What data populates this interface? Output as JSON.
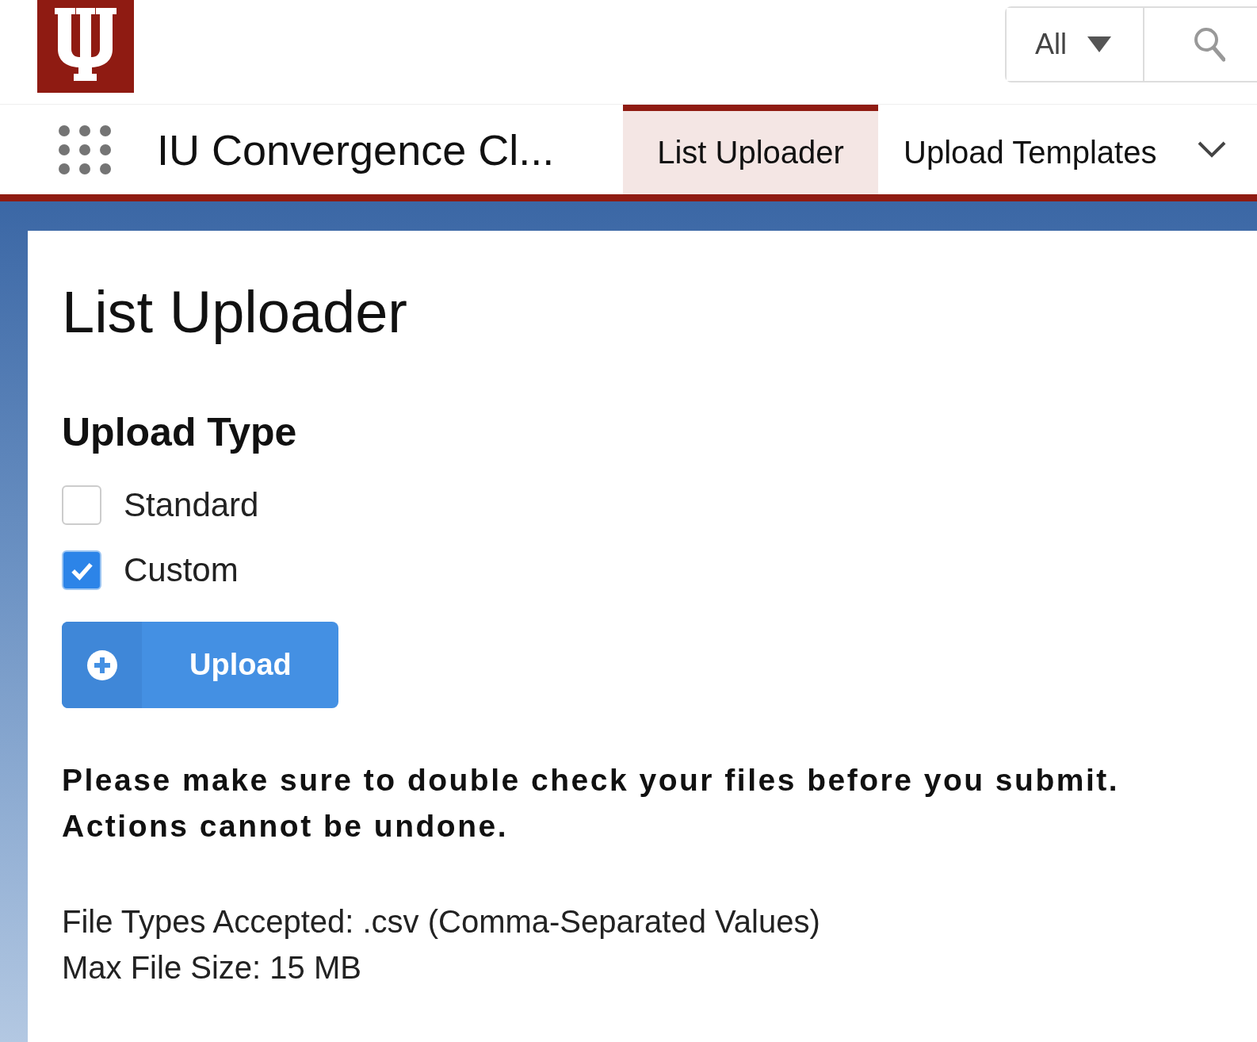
{
  "header": {
    "search_scope": "All"
  },
  "nav": {
    "app_name": "IU Convergence Cl...",
    "tabs": [
      {
        "label": "List Uploader",
        "selected": true
      },
      {
        "label": "Upload Templates",
        "selected": false
      }
    ]
  },
  "page": {
    "title": "List Uploader",
    "section_title": "Upload Type",
    "options": [
      {
        "label": "Standard",
        "checked": false
      },
      {
        "label": "Custom",
        "checked": true
      }
    ],
    "upload_button": "Upload",
    "warning": "Please make sure to double check your files before you submit. Actions cannot be undone.",
    "file_info": [
      "File Types Accepted: .csv (Comma-Separated Values)",
      "Max File Size: 15 MB"
    ]
  }
}
